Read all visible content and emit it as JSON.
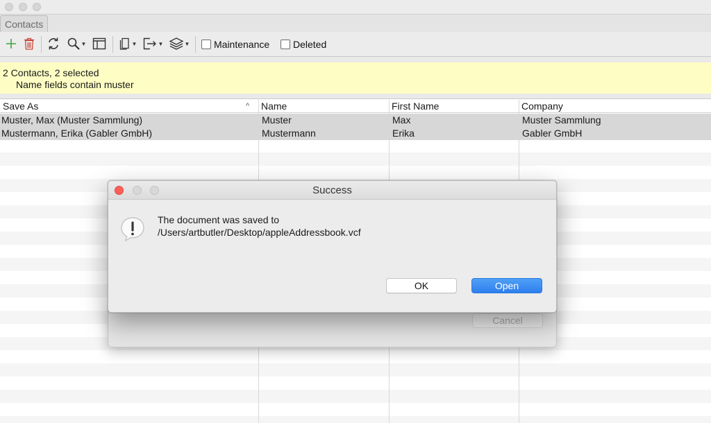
{
  "window": {
    "tab_label": "Contacts"
  },
  "toolbar": {
    "icons": [
      "add-icon",
      "trash-icon",
      "sync-icon",
      "search-icon",
      "layout-icon",
      "copy-icon",
      "export-icon",
      "layers-icon"
    ],
    "checkbox_maintenance": "Maintenance",
    "checkbox_deleted": "Deleted",
    "colors": {
      "add": "#3fa33f",
      "trash": "#c9453a"
    }
  },
  "status": {
    "line1": "2 Contacts, 2 selected",
    "line2": "Name fields contain muster"
  },
  "table": {
    "columns": [
      "Save As",
      "Name",
      "First Name",
      "Company"
    ],
    "rows": [
      [
        "Muster, Max (Muster Sammlung)",
        "Muster",
        "Max",
        "Muster Sammlung"
      ],
      [
        "Mustermann, Erika (Gabler GmbH)",
        "Mustermann",
        "Erika",
        "Gabler GmbH"
      ]
    ]
  },
  "dialog": {
    "title": "Success",
    "message_line1": "The document was saved to",
    "message_line2": "/Users/artbutler/Desktop/appleAddressbook.vcf",
    "ok_label": "OK",
    "open_label": "Open",
    "icon": "alert-icon",
    "accent": "#3b8cf3"
  },
  "background_sheet": {
    "cancel_label": "Cancel"
  }
}
